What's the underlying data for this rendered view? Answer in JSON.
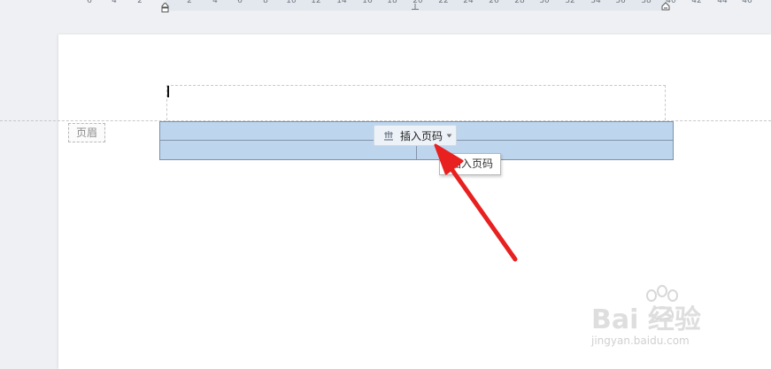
{
  "ruler": {
    "ticks": [
      "6",
      "4",
      "2",
      "2",
      "4",
      "6",
      "8",
      "10",
      "12",
      "14",
      "16",
      "18",
      "20",
      "22",
      "24",
      "26",
      "28",
      "30",
      "32",
      "34",
      "36",
      "38",
      "40",
      "42",
      "44",
      "46"
    ]
  },
  "header": {
    "label": "页眉"
  },
  "insert_button": {
    "label": "插入页码"
  },
  "tooltip": {
    "text": "插入页码"
  },
  "watermark": {
    "brand": "Bai  经验",
    "url": "jingyan.baidu.com"
  },
  "colors": {
    "table_fill": "#bdd6ee",
    "arrow": "#e8201f",
    "page": "#ffffff",
    "background": "#eef0f3"
  },
  "icons": {
    "insert_page_number": "page-number-icon",
    "dropdown": "caret-down-icon"
  }
}
